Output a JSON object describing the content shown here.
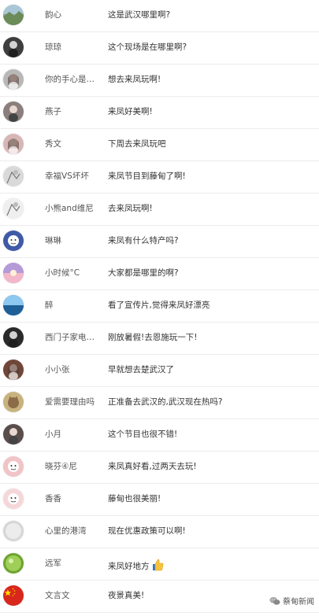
{
  "comments": [
    {
      "name": "韵心",
      "text": "这是武汉哪里啊?"
    },
    {
      "name": "琼琼",
      "text": "这个现场是在哪里啊?"
    },
    {
      "name": "你的手心是我...",
      "text": "想去来凤玩啊!"
    },
    {
      "name": "燕子",
      "text": "来凤好美啊!"
    },
    {
      "name": "秀文",
      "text": "下周去来凤玩吧"
    },
    {
      "name": "幸福VS坏坏",
      "text": "来凤节目到藤甸了啊!"
    },
    {
      "name": "小熊and维尼",
      "text": "去来凤玩啊!"
    },
    {
      "name": "琳琳",
      "text": "来凤有什么特产吗?"
    },
    {
      "name": "小时候°C",
      "text": "大家都是哪里的啊?"
    },
    {
      "name": "醉",
      "text": "看了宣传片,觉得来凤好漂亮"
    },
    {
      "name": "西门子家电刘...",
      "text": "刚放暑假!去恩施玩一下!"
    },
    {
      "name": "小小张",
      "text": "早就想去楚武汉了"
    },
    {
      "name": "爱需要理由吗",
      "text": "正准备去武汉的,武汉现在热吗?"
    },
    {
      "name": "小月",
      "text": "这个节目也很不错!"
    },
    {
      "name": "晓芬④尼",
      "text": "来凤真好看,过两天去玩!"
    },
    {
      "name": "香香",
      "text": "藤甸也很美丽!"
    },
    {
      "name": "心里的港湾",
      "text": "现在优惠政策可以啊!"
    },
    {
      "name": "远军",
      "text": "来凤好地方"
    },
    {
      "name": "文言文",
      "text": "夜景真美!"
    }
  ],
  "avatars": [
    {
      "icon": "landscape-avatar-icon",
      "color": "#8fa58d"
    },
    {
      "icon": "dark-portrait-avatar-icon",
      "color": "#3e3e3e"
    },
    {
      "icon": "girl-portrait-avatar-icon",
      "color": "#b8b8b8"
    },
    {
      "icon": "portrait-avatar-icon",
      "color": "#8a7f7c"
    },
    {
      "icon": "girl-portrait-avatar-icon",
      "color": "#d7b7b6"
    },
    {
      "icon": "sketch-avatar-icon",
      "color": "#d9d9d9"
    },
    {
      "icon": "sketch-avatar-icon",
      "color": "#efefef"
    },
    {
      "icon": "cartoon-avatar-icon",
      "color": "#3f5aa6"
    },
    {
      "icon": "sunset-avatar-icon",
      "color": "#ac8ed0"
    },
    {
      "icon": "sea-avatar-icon",
      "color": "#3d88c4"
    },
    {
      "icon": "dark-portrait-avatar-icon",
      "color": "#2a2a2a"
    },
    {
      "icon": "girl-portrait-avatar-icon",
      "color": "#6f4638"
    },
    {
      "icon": "cat-avatar-icon",
      "color": "#c8b37e"
    },
    {
      "icon": "portrait-avatar-icon",
      "color": "#5a4e4c"
    },
    {
      "icon": "cartoon-avatar-icon",
      "color": "#f1c4c7"
    },
    {
      "icon": "cartoon-avatar-icon",
      "color": "#f5d7da"
    },
    {
      "icon": "blank-avatar-icon",
      "color": "#d6d6d6"
    },
    {
      "icon": "green-ball-avatar-icon",
      "color": "#6ca42f"
    },
    {
      "icon": "flag-avatar-icon",
      "color": "#d8271d"
    }
  ],
  "watermark": {
    "text": "蔡甸新闻",
    "icon": "wechat-icon"
  },
  "thumb_emoji_icon": "thumbs-up-icon"
}
